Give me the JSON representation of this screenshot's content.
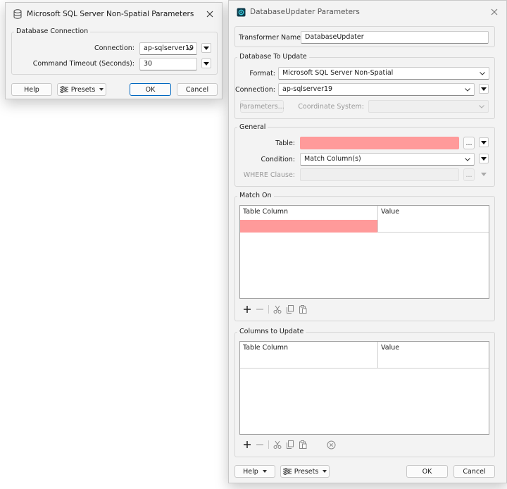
{
  "small_dialog": {
    "title": "Microsoft SQL Server Non-Spatial Parameters",
    "group_label": "Database Connection",
    "connection_label": "Connection:",
    "connection_value": "ap-sqlserver19",
    "timeout_label": "Command Timeout (Seconds):",
    "timeout_value": "30",
    "help_label": "Help",
    "presets_label": "Presets",
    "ok_label": "OK",
    "cancel_label": "Cancel"
  },
  "main_dialog": {
    "title": "DatabaseUpdater Parameters",
    "transformer_name_label": "Transformer Name:",
    "transformer_name_value": "DatabaseUpdater",
    "db_section": {
      "label": "Database To Update",
      "format_label": "Format:",
      "format_value": "Microsoft SQL Server Non-Spatial",
      "connection_label": "Connection:",
      "connection_value": "ap-sqlserver19",
      "parameters_button": "Parameters...",
      "coord_system_label": "Coordinate System:",
      "coord_system_value": ""
    },
    "general": {
      "label": "General",
      "table_label": "Table:",
      "table_value": "",
      "ellipsis": "...",
      "condition_label": "Condition:",
      "condition_value": "Match Column(s)",
      "where_label": "WHERE Clause:",
      "where_value": ""
    },
    "match_on": {
      "label": "Match On",
      "columns": [
        "Table Column",
        "Value"
      ]
    },
    "columns_to_update": {
      "label": "Columns to Update",
      "columns": [
        "Table Column",
        "Value"
      ]
    },
    "footer": {
      "help_label": "Help",
      "presets_label": "Presets",
      "ok_label": "OK",
      "cancel_label": "Cancel"
    }
  },
  "colors": {
    "required_field": "#ff9a9a",
    "dialog_bg": "#f3f3f3",
    "accent": "#0067c0"
  }
}
